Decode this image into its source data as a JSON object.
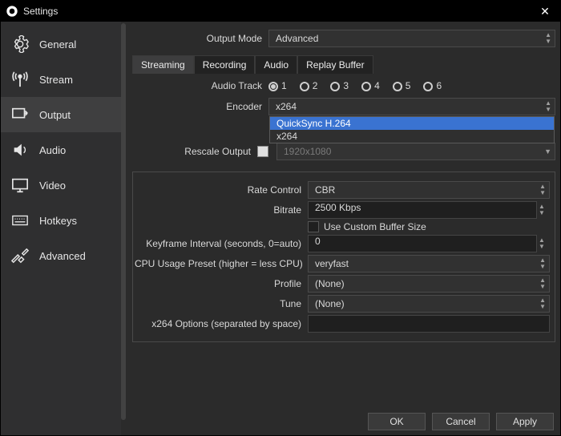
{
  "window": {
    "title": "Settings"
  },
  "sidebar": {
    "items": [
      {
        "label": "General"
      },
      {
        "label": "Stream"
      },
      {
        "label": "Output"
      },
      {
        "label": "Audio"
      },
      {
        "label": "Video"
      },
      {
        "label": "Hotkeys"
      },
      {
        "label": "Advanced"
      }
    ]
  },
  "output_mode": {
    "label": "Output Mode",
    "value": "Advanced"
  },
  "tabs": [
    "Streaming",
    "Recording",
    "Audio",
    "Replay Buffer"
  ],
  "audio_track": {
    "label": "Audio Track",
    "options": [
      "1",
      "2",
      "3",
      "4",
      "5",
      "6"
    ],
    "selected": "1"
  },
  "encoder": {
    "label": "Encoder",
    "value": "x264",
    "options": [
      "QuickSync H.264",
      "x264"
    ],
    "highlighted": 0
  },
  "rescale": {
    "label": "Rescale Output",
    "checked": false,
    "value": "1920x1080"
  },
  "settings": {
    "rate_control": {
      "label": "Rate Control",
      "value": "CBR"
    },
    "bitrate": {
      "label": "Bitrate",
      "value": "2500 Kbps"
    },
    "custom_buffer": {
      "label": "Use Custom Buffer Size",
      "checked": false
    },
    "keyframe": {
      "label": "Keyframe Interval (seconds, 0=auto)",
      "value": "0"
    },
    "cpu_preset": {
      "label": "CPU Usage Preset (higher = less CPU)",
      "value": "veryfast"
    },
    "profile": {
      "label": "Profile",
      "value": "(None)"
    },
    "tune": {
      "label": "Tune",
      "value": "(None)"
    },
    "x264_opts": {
      "label": "x264 Options (separated by space)",
      "value": ""
    }
  },
  "buttons": {
    "ok": "OK",
    "cancel": "Cancel",
    "apply": "Apply"
  }
}
